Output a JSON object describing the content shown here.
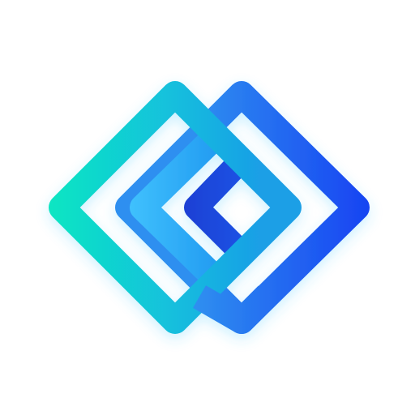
{
  "logo": {
    "name": "interlocking-diamonds-logo",
    "colors": {
      "background": "#ffffff",
      "teal": "#14e0c4",
      "cyan": "#1fb8e6",
      "light_blue": "#3cbcff",
      "blue": "#2a7cf2",
      "deep_blue": "#1a4cf2",
      "navy": "#1840d0"
    }
  }
}
